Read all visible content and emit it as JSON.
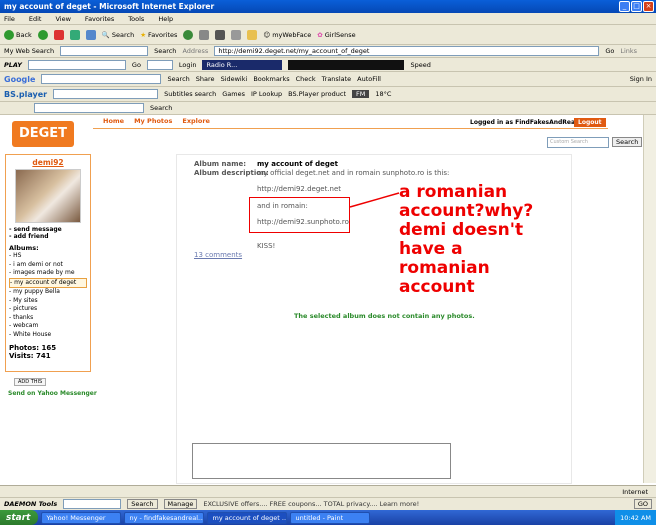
{
  "window": {
    "title": "my account of deget - Microsoft Internet Explorer"
  },
  "menu": [
    "File",
    "Edit",
    "View",
    "Favorites",
    "Tools",
    "Help"
  ],
  "toolbar": {
    "back": "Back",
    "search": "Search",
    "favorites": "Favorites",
    "mywebface": "myWebFace",
    "girlsense": "GirlSense"
  },
  "mywebsearch": {
    "label": "My Web Search",
    "search_btn": "Search",
    "address_label": "Address",
    "url": "http://demi92.deget.net/my_account_of_deget",
    "go": "Go",
    "links": "Links"
  },
  "playbar": {
    "play": "PLAY",
    "go": "Go",
    "login": "Login",
    "radio": "Radio R...",
    "speed": "Speed"
  },
  "googlebar": {
    "logo": "Google",
    "search": "Search",
    "share": "Share",
    "sidewiki": "Sidewiki",
    "bookmarks": "Bookmarks",
    "check": "Check",
    "translate": "Translate",
    "autofill": "AutoFill",
    "signin": "Sign In"
  },
  "bsbar": {
    "logo": "BS.player",
    "subtitles": "Subtitles search",
    "games": "Games",
    "iplookup": "IP Lookup",
    "bsproduct": "BS.Player product",
    "fm": "FM",
    "temp": "18°C"
  },
  "searchbar2": {
    "search": "Search"
  },
  "site": {
    "logo": "DEGET",
    "nav": [
      "Home",
      "My Photos",
      "Explore"
    ],
    "logged_in": "Logged in as FindFakesAndReals.",
    "logout": "Logout",
    "search_placeholder": "Custom Search",
    "search_btn": "Search"
  },
  "sidebar": {
    "username": "demi92",
    "send_message": "- send message",
    "add_friend": "- add friend",
    "albums_label": "Albums:",
    "albums": [
      "- HS",
      "- i am demi or not",
      "- images made by me",
      "- my account of deget",
      "- my puppy Bella",
      "- My sites",
      "- pictures",
      "- thanks",
      "- webcam",
      "- White House"
    ],
    "selected_album_index": 3,
    "photos": "Photos: 165",
    "visits": "Visits: 741",
    "add_this": "ADD THIS",
    "yahoo": "Send on Yahoo Messenger"
  },
  "album": {
    "name_label": "Album name:",
    "name": "my account of deget",
    "desc_label": "Album description:",
    "desc": "my official deget.net and in romain sunphoto.ro is this:",
    "line1": "http://demi92.deget.net",
    "line2": "and in romain:",
    "line3": "http://demi92.sunphoto.ro",
    "kiss": "KISS!",
    "comments": "13 comments",
    "empty_msg": "The selected album does not contain any photos."
  },
  "annotation": [
    "a romanian",
    "account?why?",
    "demi doesn't",
    "have a",
    "romanian",
    "account"
  ],
  "daemon": {
    "label": "DAEMON Tools",
    "search": "Search",
    "manage": "Manage",
    "promo": "EXCLUSIVE offers.... FREE coupons... TOTAL privacy.... Learn more!",
    "zone": "Internet",
    "go": "GO"
  },
  "taskbar": {
    "start": "start",
    "tasks": [
      "Yahoo! Messenger",
      "ny - findfakesandreal...",
      "my account of deget ...",
      "untitled - Paint"
    ],
    "active_index": 2,
    "clock": "10:42 AM"
  },
  "colors": {
    "accent": "#e05a10",
    "annotation": "#e00000",
    "green_msg": "#2a8a2a"
  }
}
